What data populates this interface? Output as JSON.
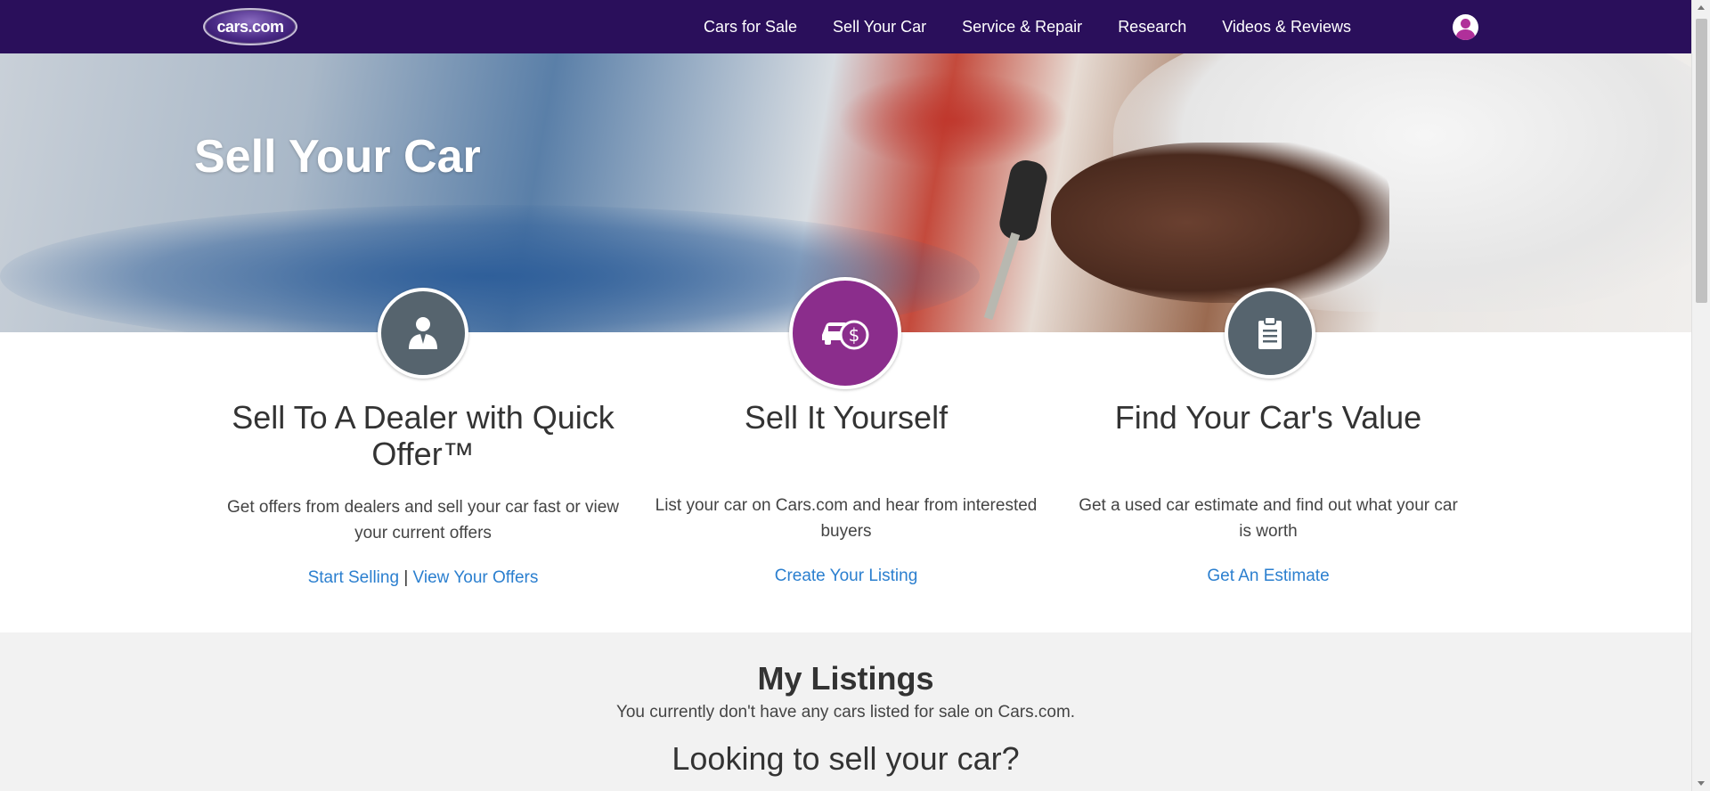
{
  "header": {
    "logo_text": "cars.com",
    "nav": [
      {
        "label": "Cars for Sale"
      },
      {
        "label": "Sell Your Car"
      },
      {
        "label": "Service & Repair"
      },
      {
        "label": "Research"
      },
      {
        "label": "Videos & Reviews"
      }
    ],
    "profile_icon": "user-avatar-icon"
  },
  "hero": {
    "title": "Sell Your Car"
  },
  "features": [
    {
      "icon": "dealer-person-icon",
      "title": "Sell To A Dealer with Quick Offer™",
      "description": "Get offers from dealers and sell your car fast or view your current offers",
      "link1": "Start Selling",
      "separator": "|",
      "link2": "View Your Offers"
    },
    {
      "icon": "car-dollar-icon",
      "title": "Sell It Yourself",
      "description": "List your car on Cars.com and hear from interested buyers",
      "link1": "Create Your Listing"
    },
    {
      "icon": "clipboard-icon",
      "title": "Find Your Car's Value",
      "description": "Get a used car estimate and find out what your car is worth",
      "link1": "Get An Estimate"
    }
  ],
  "listings": {
    "title": "My Listings",
    "message": "You currently don't have any cars listed for sale on Cars.com.",
    "subtitle": "Looking to sell your car?"
  },
  "colors": {
    "nav_bg": "#2a0f5b",
    "accent_purple": "#8b2d8c",
    "icon_gray": "#56646e",
    "link_blue": "#2b7fcf"
  }
}
